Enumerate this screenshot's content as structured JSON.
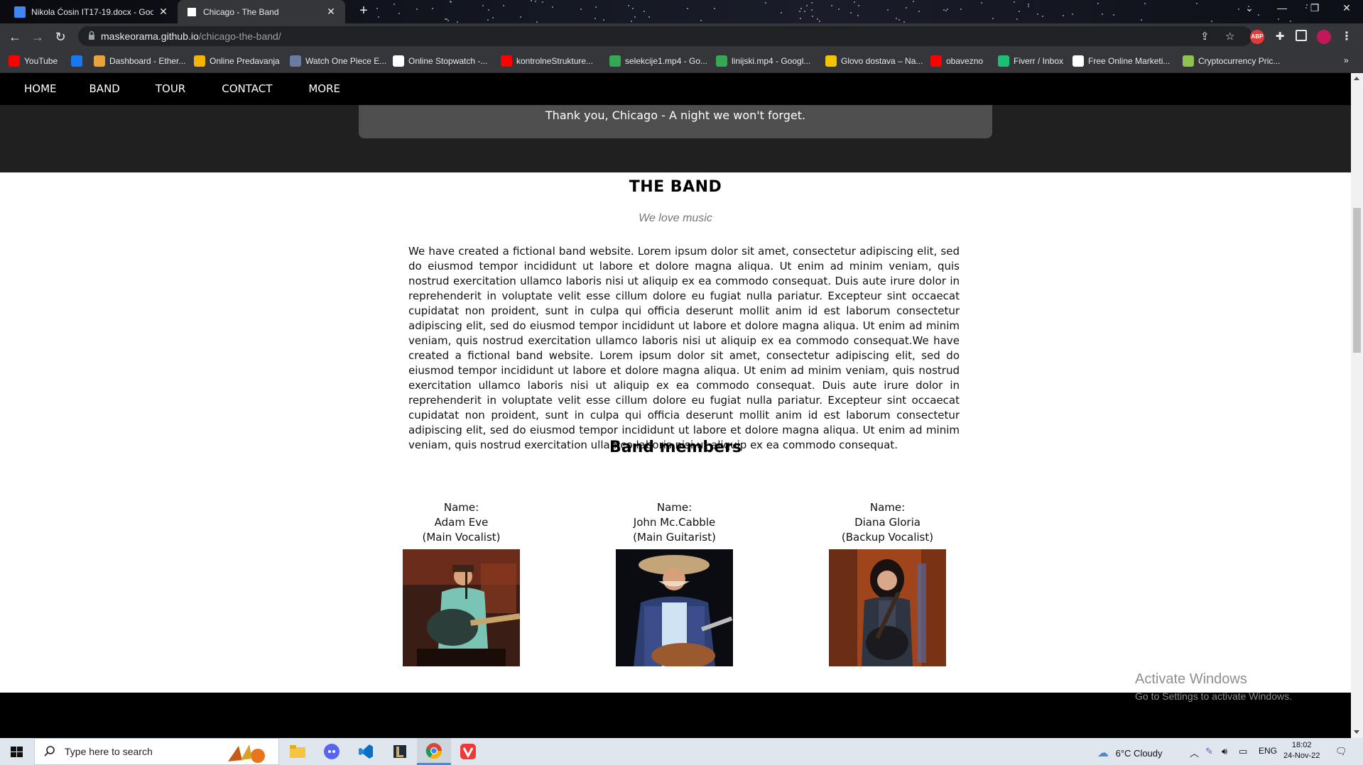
{
  "browser": {
    "tabs": [
      {
        "title": "Nikola Ćosin IT17-19.docx - Goo",
        "active": false,
        "icon": "google-docs-icon"
      },
      {
        "title": "Chicago - The Band",
        "active": true,
        "icon": "w3-icon"
      }
    ],
    "new_tab": "+",
    "url_host": "maskeorama.github.io",
    "url_path": "/chicago-the-band/",
    "bookmarks": [
      {
        "label": "YouTube",
        "color": "#ff0000"
      },
      {
        "label": "",
        "color": "#1877f2"
      },
      {
        "label": "Dashboard - Ether...",
        "color": "#e8a33c"
      },
      {
        "label": "Online Predavanja",
        "color": "#f5b400"
      },
      {
        "label": "Watch One Piece E...",
        "color": "#6a7ba2"
      },
      {
        "label": "Online Stopwatch -...",
        "color": "#ffffff"
      },
      {
        "label": "kontrolneStrukture...",
        "color": "#ff0000"
      },
      {
        "label": "selekcije1.mp4 - Go...",
        "color": "#34a853"
      },
      {
        "label": "linijski.mp4 - Googl...",
        "color": "#34a853"
      },
      {
        "label": "Glovo dostava – Na...",
        "color": "#f5c400"
      },
      {
        "label": "obavezno",
        "color": "#ff0000"
      },
      {
        "label": "Fiverr / Inbox",
        "color": "#1dbf73"
      },
      {
        "label": "Free Online Marketi...",
        "color": "#ffffff"
      },
      {
        "label": "Cryptocurrency Pric...",
        "color": "#8dc351"
      }
    ]
  },
  "site": {
    "nav": [
      "HOME",
      "BAND",
      "TOUR",
      "CONTACT",
      "MORE"
    ],
    "hero_caption": "Thank you, Chicago - A night we won't forget.",
    "band_title": "THE BAND",
    "band_subtitle": "We love music",
    "band_text": "We have created a fictional band website. Lorem ipsum dolor sit amet, consectetur adipiscing elit, sed do eiusmod tempor incididunt ut labore et dolore magna aliqua. Ut enim ad minim veniam, quis nostrud exercitation ullamco laboris nisi ut aliquip ex ea commodo consequat. Duis aute irure dolor in reprehenderit in voluptate velit esse cillum dolore eu fugiat nulla pariatur. Excepteur sint occaecat cupidatat non proident, sunt in culpa qui officia deserunt mollit anim id est laborum consectetur adipiscing elit, sed do eiusmod tempor incididunt ut labore et dolore magna aliqua. Ut enim ad minim veniam, quis nostrud exercitation ullamco laboris nisi ut aliquip ex ea commodo consequat.We have created a fictional band website. Lorem ipsum dolor sit amet, consectetur adipiscing elit, sed do eiusmod tempor incididunt ut labore et dolore magna aliqua. Ut enim ad minim veniam, quis nostrud exercitation ullamco laboris nisi ut aliquip ex ea commodo consequat. Duis aute irure dolor in reprehenderit in voluptate velit esse cillum dolore eu fugiat nulla pariatur. Excepteur sint occaecat cupidatat non proident, sunt in culpa qui officia deserunt mollit anim id est laborum consectetur adipiscing elit, sed do eiusmod tempor incididunt ut labore et dolore magna aliqua. Ut enim ad minim veniam, quis nostrud exercitation ullamco laboris nisi ut aliquip ex ea commodo consequat.",
    "members_title": "Band members",
    "members": [
      {
        "name_label": "Name:",
        "name": "Adam Eve",
        "role": "(Main Vocalist)"
      },
      {
        "name_label": "Name:",
        "name": "John Mc.Cabble",
        "role": "(Main Guitarist)"
      },
      {
        "name_label": "Name:",
        "name": "Diana Gloria",
        "role": "(Backup Vocalist)"
      }
    ]
  },
  "watermark": {
    "line1": "Activate Windows",
    "line2": "Go to Settings to activate Windows."
  },
  "taskbar": {
    "search_placeholder": "Type here to search",
    "weather": "6°C  Cloudy",
    "language": "ENG",
    "time": "18:02",
    "date": "24-Nov-22"
  }
}
